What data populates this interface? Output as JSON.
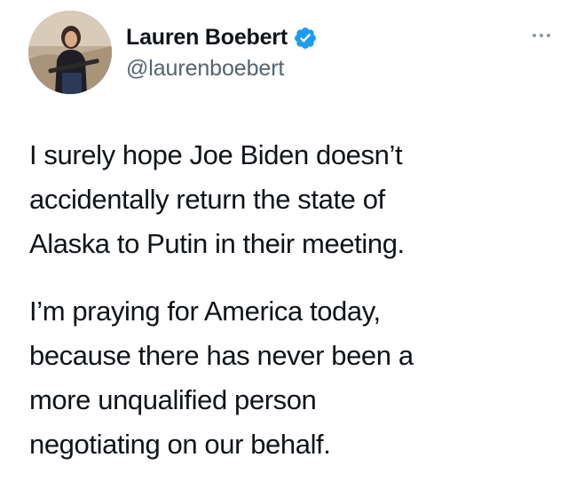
{
  "author": {
    "display_name": "Lauren Boebert",
    "handle": "@laurenboebert",
    "verified_icon": "verified-badge-icon",
    "avatar": "profile-photo"
  },
  "tweet": {
    "paragraph_1": [
      "I surely hope Joe Biden doesn’t",
      "accidentally return the state of",
      "Alaska to Putin in their meeting."
    ],
    "paragraph_2": [
      "I’m praying for America today,",
      "because there has never been a",
      "more unqualified person",
      "negotiating on our behalf."
    ]
  },
  "menu_icon": "more-options-icon",
  "colors": {
    "text": "#0f1419",
    "secondary_text": "#536471",
    "verified_blue": "#1d9bf0",
    "background": "#ffffff"
  }
}
